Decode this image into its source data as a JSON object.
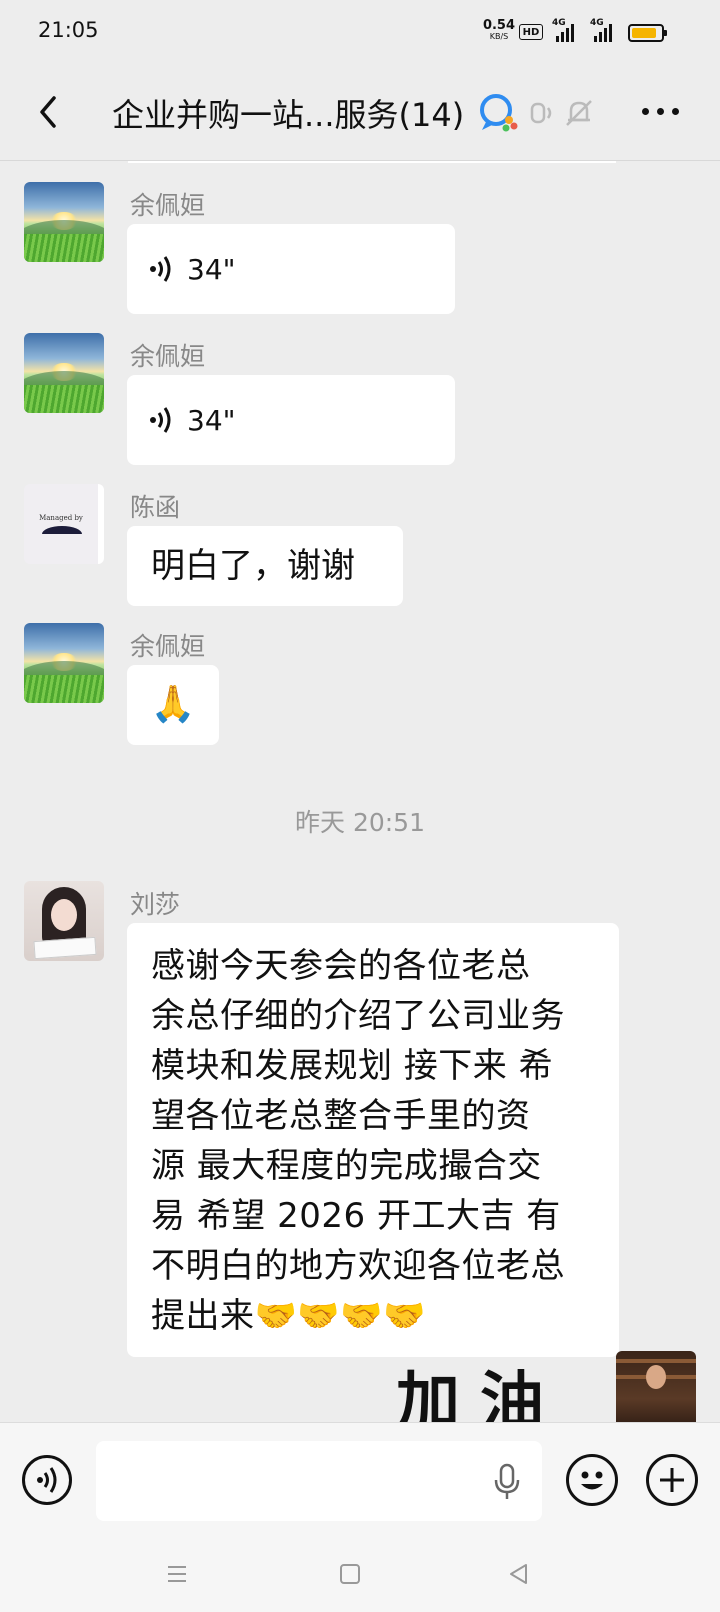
{
  "status_bar": {
    "time": "21:05",
    "net_speed": "0.54",
    "net_unit": "KB/S",
    "hd_badge": "HD",
    "signal1_label": "4G",
    "signal2_label": "4G",
    "battery_level": 0.85,
    "battery_color": "#f5b400"
  },
  "header": {
    "title": "企业并购一站...服务(14)",
    "icons": [
      "back-icon",
      "wecom-icon",
      "voice-mute-icon",
      "bell-off-icon",
      "more-icon"
    ]
  },
  "messages": [
    {
      "sender": "余佩姮",
      "type": "voice",
      "duration": "34\""
    },
    {
      "sender": "余佩姮",
      "type": "voice",
      "duration": "34\""
    },
    {
      "sender": "陈函",
      "type": "text",
      "text": "明白了，谢谢",
      "avatar_text": "Managed by"
    },
    {
      "sender": "余佩姮",
      "type": "emoji",
      "text": "🙏"
    }
  ],
  "timestamp": "昨天 20:51",
  "long_message": {
    "sender": "刘莎",
    "lines": [
      "感谢今天参会的各位老总",
      "余总仔细的介绍了公司业务",
      "模块和发展规划 接下来 希",
      "望各位老总整合手里的资",
      "源 最大程度的完成撮合交",
      "易 希望 2026 开工大吉  有",
      "不明白的地方欢迎各位老总",
      "提出来🤝🤝🤝🤝"
    ]
  },
  "partial_message_text": "加油",
  "input_bar": {
    "value": "",
    "icons": [
      "voice-mode-icon",
      "microphone-icon",
      "emoji-icon",
      "plus-icon"
    ]
  },
  "nav_bar": {
    "icons": [
      "menu-icon",
      "home-icon",
      "back-triangle-icon"
    ]
  }
}
